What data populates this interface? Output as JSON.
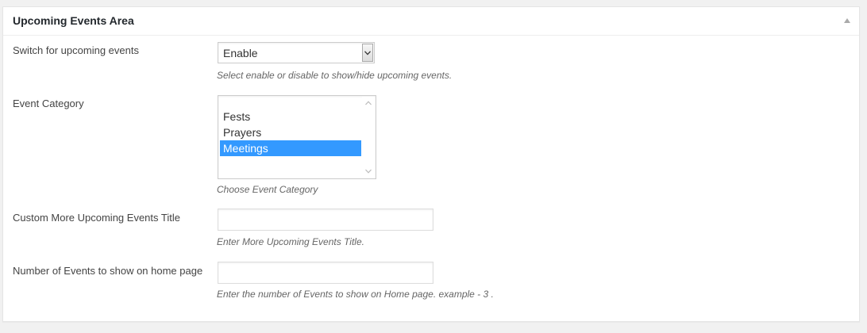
{
  "panel": {
    "title": "Upcoming Events Area"
  },
  "fields": {
    "switch": {
      "label": "Switch for upcoming events",
      "selected_value": "Enable",
      "description": "Select enable or disable to show/hide upcoming events."
    },
    "category": {
      "label": "Event Category",
      "options": [
        "Fests",
        "Prayers",
        "Meetings"
      ],
      "selected": "Meetings",
      "description": "Choose Event Category"
    },
    "more_title": {
      "label": "Custom More Upcoming Events Title",
      "value": "",
      "description": "Enter More Upcoming Events Title."
    },
    "event_count": {
      "label": "Number of Events to show on home page",
      "value": "",
      "description": "Enter the number of Events to show on Home page. example - 3 ."
    }
  },
  "colors": {
    "selection": "#3399ff",
    "page_background": "#f1f1f1",
    "panel_background": "#ffffff"
  }
}
